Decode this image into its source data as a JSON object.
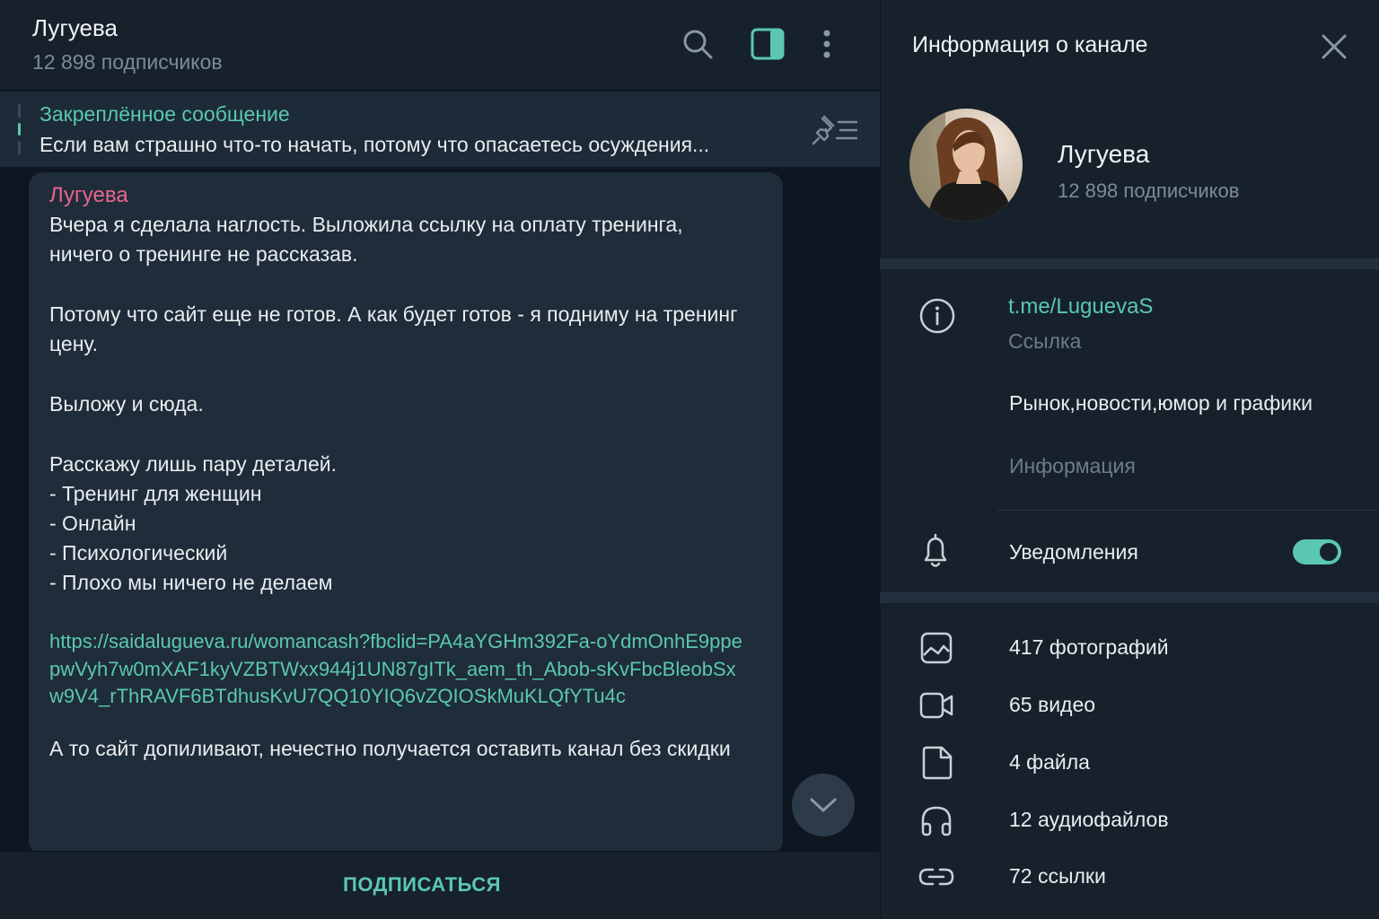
{
  "chat": {
    "title": "Лугуева",
    "subtitle": "12 898 подписчиков",
    "pinned": {
      "label": "Закреплённое сообщение",
      "text": "Если вам страшно что-то начать, потому что опасаетесь осуждения..."
    },
    "message": {
      "author": "Лугуева",
      "p1": "Вчера я сделала наглость. Выложила ссылку на оплату тренинга, ничего о тренинге не рассказав.",
      "p2": "Потому что сайт еще не готов. А как будет готов - я подниму на тренинг цену.",
      "p3": "Выложу и сюда.",
      "p4": "Расскажу лишь пару деталей.",
      "list": [
        "- Тренинг для женщин",
        "- Онлайн",
        "- Психологический",
        "- Плохо мы ничего не делаем"
      ],
      "link": "https://saidalugueva.ru/womancash?fbclid=PA4aYGHm392Fa-oYdmOnhE9ppepwVyh7w0mXAF1kyVZBTWxx944j1UN87gITk_aem_th_Abob-sKvFbcBleobSxw9V4_rThRAVF6BTdhusKvU7QQ10YIQ6vZQIOSkMuKLQfYTu4c",
      "p5": "А то сайт допиливают, нечестно получается оставить канал без скидки"
    },
    "subscribe_label": "ПОДПИСАТЬСЯ"
  },
  "panel": {
    "title": "Информация о канале",
    "name": "Лугуева",
    "subscribers": "12 898 подписчиков",
    "link": "t.me/LuguevaS",
    "link_caption": "Ссылка",
    "description": "Рынок,новости,юмор и графики",
    "description_caption": "Информация",
    "notifications_label": "Уведомления",
    "notifications_on": true,
    "media": {
      "photos": "417 фотографий",
      "videos": "65 видео",
      "files": "4 файла",
      "audio": "12 аудиофайлов",
      "links": "72 ссылки"
    }
  },
  "colors": {
    "accent": "#5ac8b0",
    "author": "#e8668e",
    "background": "#17212b",
    "chat_background": "#0e1621",
    "bubble": "#1f2c39"
  },
  "icons": {
    "header": [
      "search-icon",
      "sidebar-toggle-icon",
      "more-vertical-icon"
    ],
    "pinned": "pin-list-icon",
    "panel": [
      "close-icon",
      "info-icon",
      "bell-icon",
      "photo-icon",
      "video-icon",
      "file-icon",
      "headphones-icon",
      "link-icon"
    ],
    "scroll": "chevron-down-icon"
  }
}
